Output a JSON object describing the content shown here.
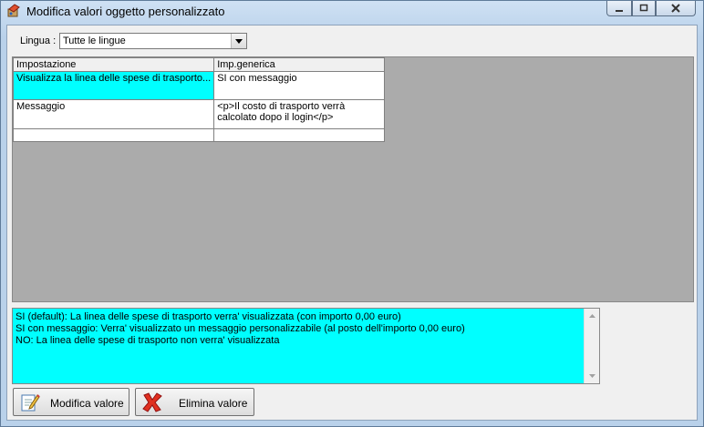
{
  "window": {
    "title": "Modifica valori oggetto personalizzato",
    "icon": "app-icon"
  },
  "language": {
    "label": "Lingua :",
    "selected": "Tutte le lingue"
  },
  "grid": {
    "columns": [
      "Impostazione",
      "Imp.generica"
    ],
    "rows": [
      {
        "setting": "Visualizza la linea delle spese di trasporto...",
        "value": "SI con messaggio"
      },
      {
        "setting": "Messaggio",
        "value": "<p>Il costo di trasporto verrà calcolato dopo il login</p>"
      },
      {
        "setting": "",
        "value": ""
      }
    ]
  },
  "description": {
    "lines": [
      "SI (default): La linea delle spese di trasporto verra' visualizzata (con importo 0,00 euro)",
      "SI con messaggio: Verra' visualizzato un messaggio personalizzabile (al posto dell'importo 0,00 euro)",
      "NO: La linea delle spese di trasporto non verra' visualizzata"
    ]
  },
  "buttons": {
    "edit_label": "Modifica valore",
    "delete_label": "Elimina valore"
  },
  "colors": {
    "selection": "#00ffff",
    "grid_background": "#ababab",
    "delete_icon": "#e03020"
  }
}
